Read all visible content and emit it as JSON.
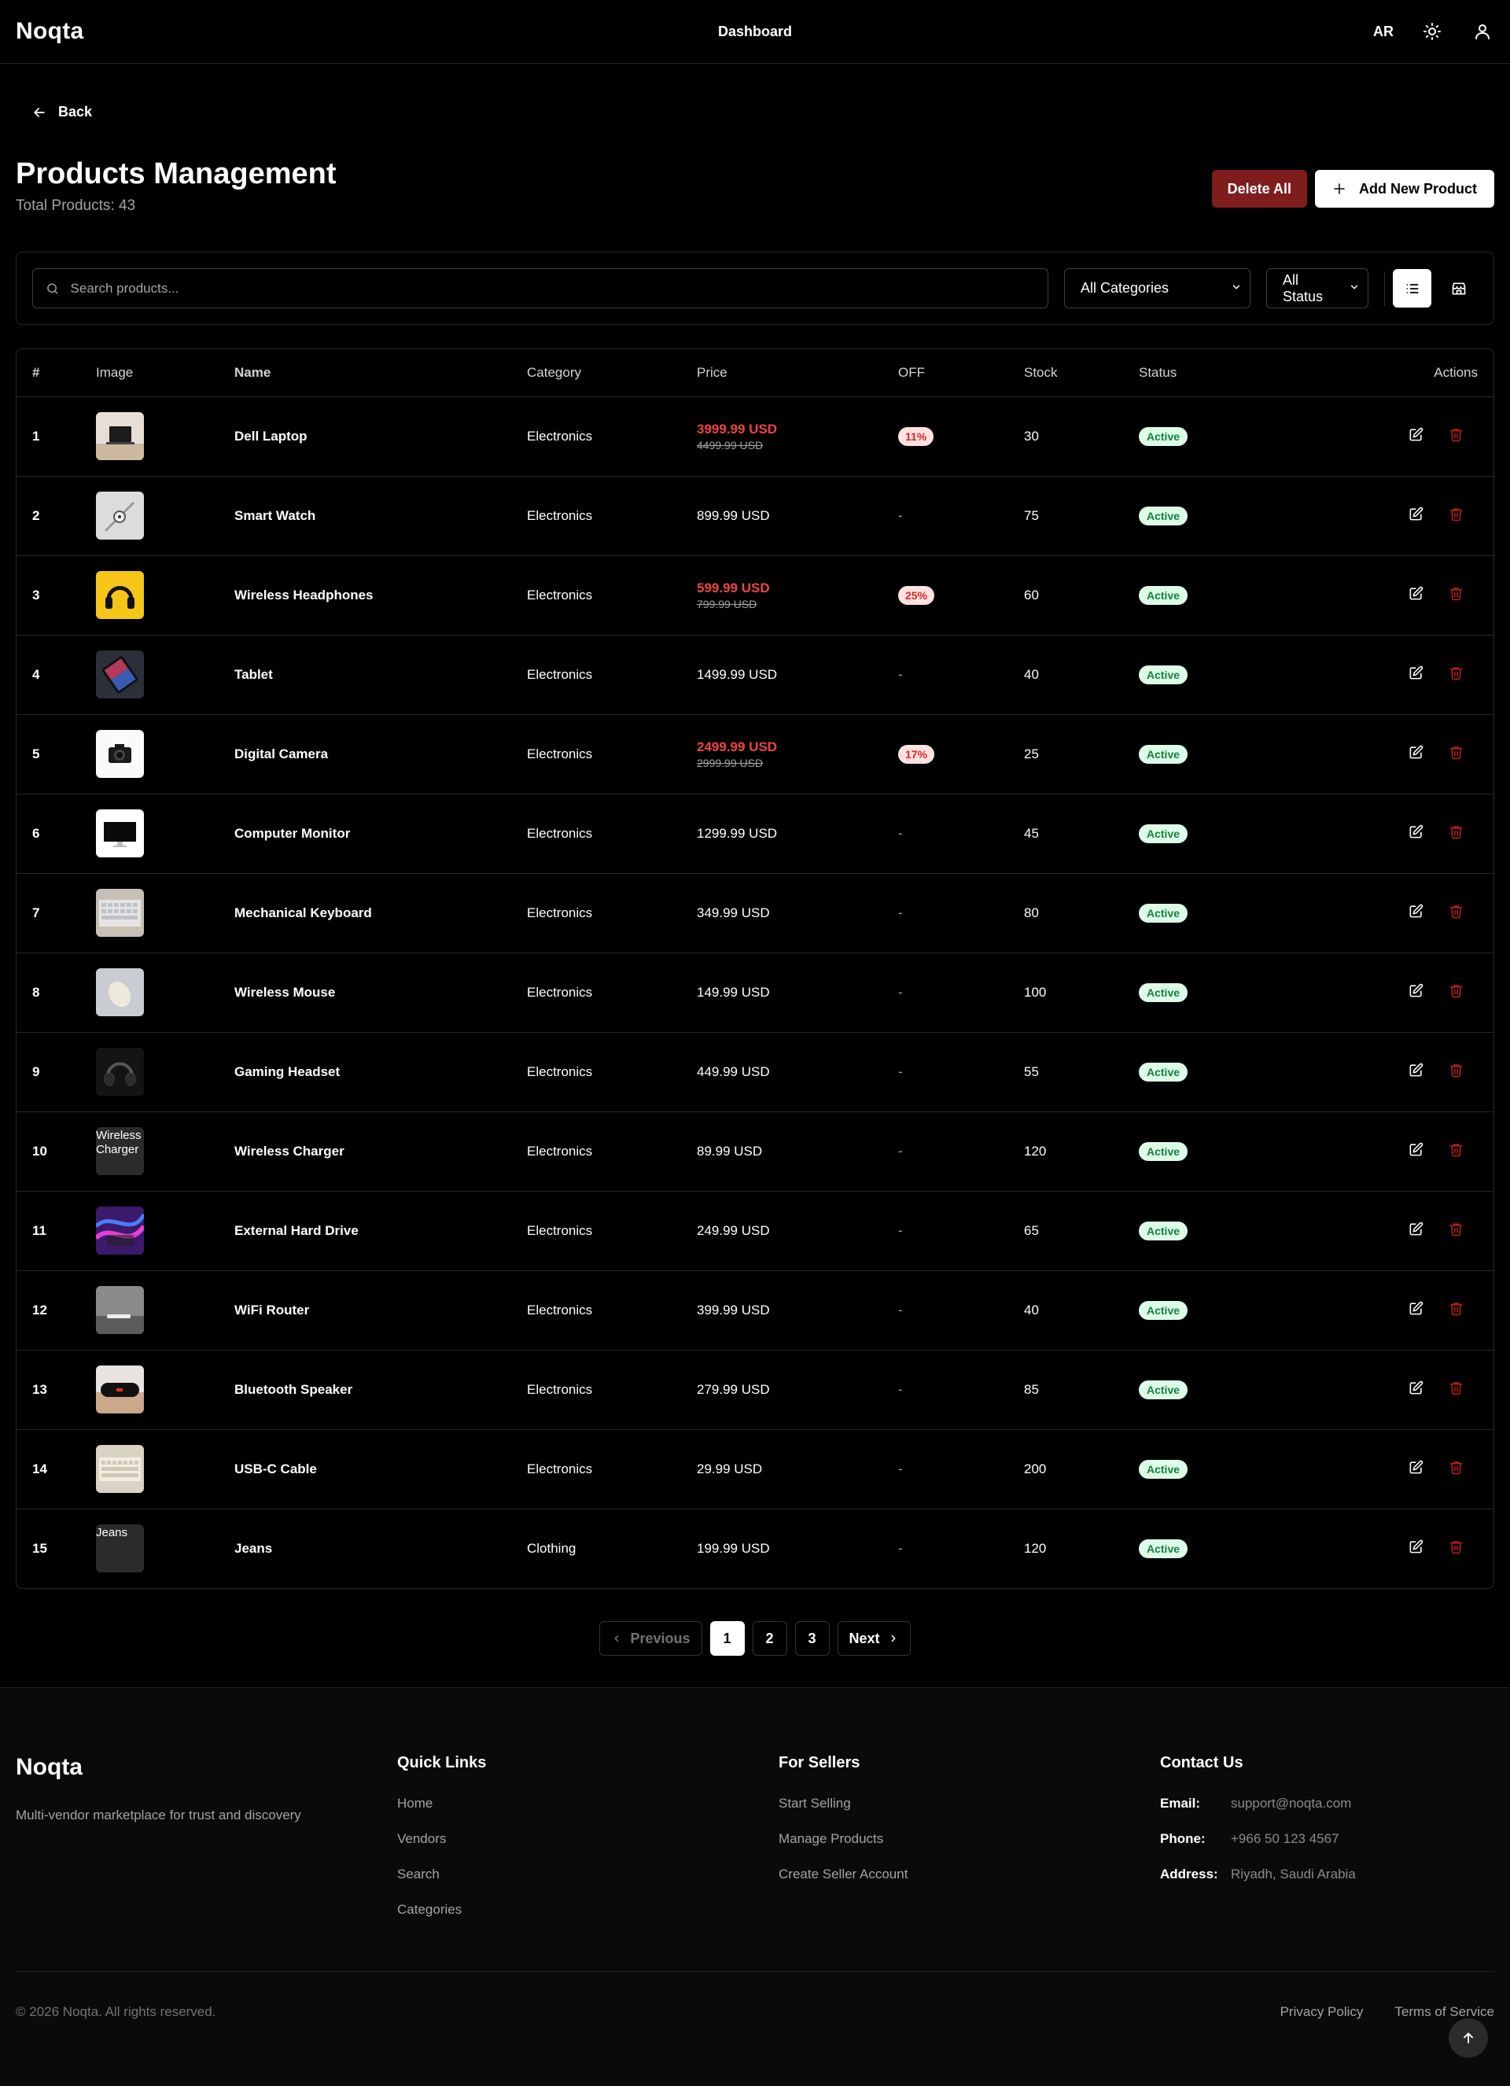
{
  "header": {
    "brand": "Noqta",
    "nav_dashboard": "Dashboard",
    "lang": "AR",
    "theme_icon": "sun-icon",
    "user_icon": "user-icon"
  },
  "back_label": "Back",
  "page": {
    "title": "Products Management",
    "subtitle": "Total Products: 43",
    "delete_all": "Delete All",
    "add_new": "Add New Product"
  },
  "filters": {
    "search_placeholder": "Search products...",
    "category": "All Categories",
    "status": "All Status"
  },
  "table": {
    "columns": [
      "#",
      "Image",
      "Name",
      "Category",
      "Price",
      "OFF",
      "Stock",
      "Status",
      "Actions"
    ],
    "rows": [
      {
        "num": "1",
        "name": "Dell Laptop",
        "category": "Electronics",
        "price": "3999.99 USD",
        "old_price": "4499.99 USD",
        "off": "11%",
        "stock": "30",
        "status": "Active",
        "img": "laptop"
      },
      {
        "num": "2",
        "name": "Smart Watch",
        "category": "Electronics",
        "price": "899.99 USD",
        "old_price": "",
        "off": "-",
        "stock": "75",
        "status": "Active",
        "img": "watch"
      },
      {
        "num": "3",
        "name": "Wireless Headphones",
        "category": "Electronics",
        "price": "599.99 USD",
        "old_price": "799.99 USD",
        "off": "25%",
        "stock": "60",
        "status": "Active",
        "img": "headphones"
      },
      {
        "num": "4",
        "name": "Tablet",
        "category": "Electronics",
        "price": "1499.99 USD",
        "old_price": "",
        "off": "-",
        "stock": "40",
        "status": "Active",
        "img": "tablet"
      },
      {
        "num": "5",
        "name": "Digital Camera",
        "category": "Electronics",
        "price": "2499.99 USD",
        "old_price": "2999.99 USD",
        "off": "17%",
        "stock": "25",
        "status": "Active",
        "img": "camera"
      },
      {
        "num": "6",
        "name": "Computer Monitor",
        "category": "Electronics",
        "price": "1299.99 USD",
        "old_price": "",
        "off": "-",
        "stock": "45",
        "status": "Active",
        "img": "monitor"
      },
      {
        "num": "7",
        "name": "Mechanical Keyboard",
        "category": "Electronics",
        "price": "349.99 USD",
        "old_price": "",
        "off": "-",
        "stock": "80",
        "status": "Active",
        "img": "keyboard"
      },
      {
        "num": "8",
        "name": "Wireless Mouse",
        "category": "Electronics",
        "price": "149.99 USD",
        "old_price": "",
        "off": "-",
        "stock": "100",
        "status": "Active",
        "img": "mouse"
      },
      {
        "num": "9",
        "name": "Gaming Headset",
        "category": "Electronics",
        "price": "449.99 USD",
        "old_price": "",
        "off": "-",
        "stock": "55",
        "status": "Active",
        "img": "headset"
      },
      {
        "num": "10",
        "name": "Wireless Charger",
        "category": "Electronics",
        "price": "89.99 USD",
        "old_price": "",
        "off": "-",
        "stock": "120",
        "status": "Active",
        "img": "broken",
        "alt": "Wireless Charger"
      },
      {
        "num": "11",
        "name": "External Hard Drive",
        "category": "Electronics",
        "price": "249.99 USD",
        "old_price": "",
        "off": "-",
        "stock": "65",
        "status": "Active",
        "img": "drive"
      },
      {
        "num": "12",
        "name": "WiFi Router",
        "category": "Electronics",
        "price": "399.99 USD",
        "old_price": "",
        "off": "-",
        "stock": "40",
        "status": "Active",
        "img": "router"
      },
      {
        "num": "13",
        "name": "Bluetooth Speaker",
        "category": "Electronics",
        "price": "279.99 USD",
        "old_price": "",
        "off": "-",
        "stock": "85",
        "status": "Active",
        "img": "speaker"
      },
      {
        "num": "14",
        "name": "USB-C Cable",
        "category": "Electronics",
        "price": "29.99 USD",
        "old_price": "",
        "off": "-",
        "stock": "200",
        "status": "Active",
        "img": "cable"
      },
      {
        "num": "15",
        "name": "Jeans",
        "category": "Clothing",
        "price": "199.99 USD",
        "old_price": "",
        "off": "-",
        "stock": "120",
        "status": "Active",
        "img": "broken",
        "alt": "Jeans"
      }
    ]
  },
  "pagination": {
    "previous": "Previous",
    "pages": [
      "1",
      "2",
      "3"
    ],
    "next": "Next"
  },
  "footer": {
    "brand": "Noqta",
    "tagline": "Multi-vendor marketplace for trust and discovery",
    "quick_links_title": "Quick Links",
    "quick_links": [
      "Home",
      "Vendors",
      "Search",
      "Categories"
    ],
    "sellers_title": "For Sellers",
    "sellers_links": [
      "Start Selling",
      "Manage Products",
      "Create Seller Account"
    ],
    "contact_title": "Contact Us",
    "contact": [
      {
        "label": "Email:",
        "value": "support@noqta.com"
      },
      {
        "label": "Phone:",
        "value": "+966 50 123 4567"
      },
      {
        "label": "Address:",
        "value": "Riyadh, Saudi Arabia"
      }
    ],
    "copyright": "© 2026 Noqta. All rights reserved.",
    "privacy": "Privacy Policy",
    "terms": "Terms of Service"
  }
}
